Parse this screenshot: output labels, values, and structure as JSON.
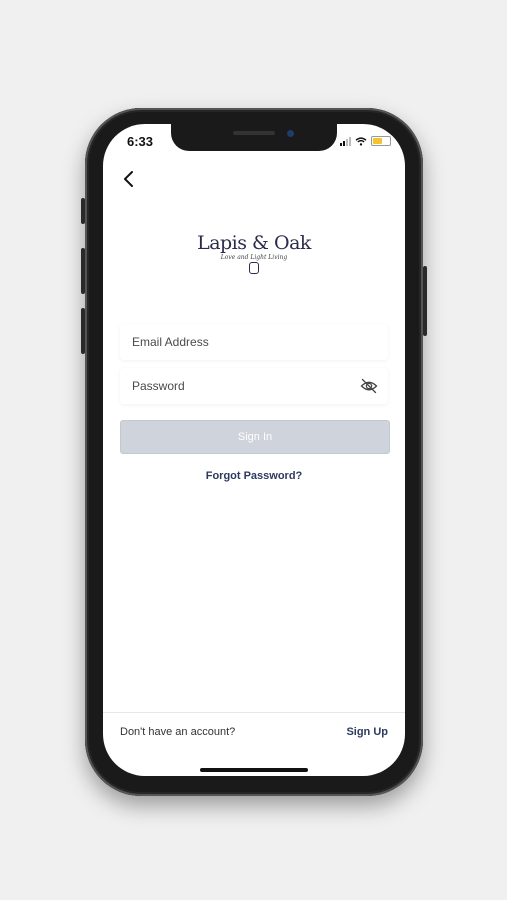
{
  "status_bar": {
    "time": "6:33"
  },
  "brand": {
    "name": "Lapis & Oak",
    "tagline": "Love and Light Living"
  },
  "form": {
    "email_placeholder": "Email Address",
    "password_placeholder": "Password",
    "signin_label": "Sign In",
    "forgot_label": "Forgot Password?"
  },
  "footer": {
    "prompt": "Don't have an account?",
    "signup_label": "Sign Up"
  },
  "colors": {
    "brand_navy": "#2b2c4c",
    "link": "#2c3a5e",
    "button_disabled": "#cfd3db",
    "battery": "#f4c430"
  },
  "icons": [
    "back-chevron-icon",
    "eye-slash-icon",
    "wifi-icon",
    "cellular-signal-icon",
    "battery-icon"
  ]
}
